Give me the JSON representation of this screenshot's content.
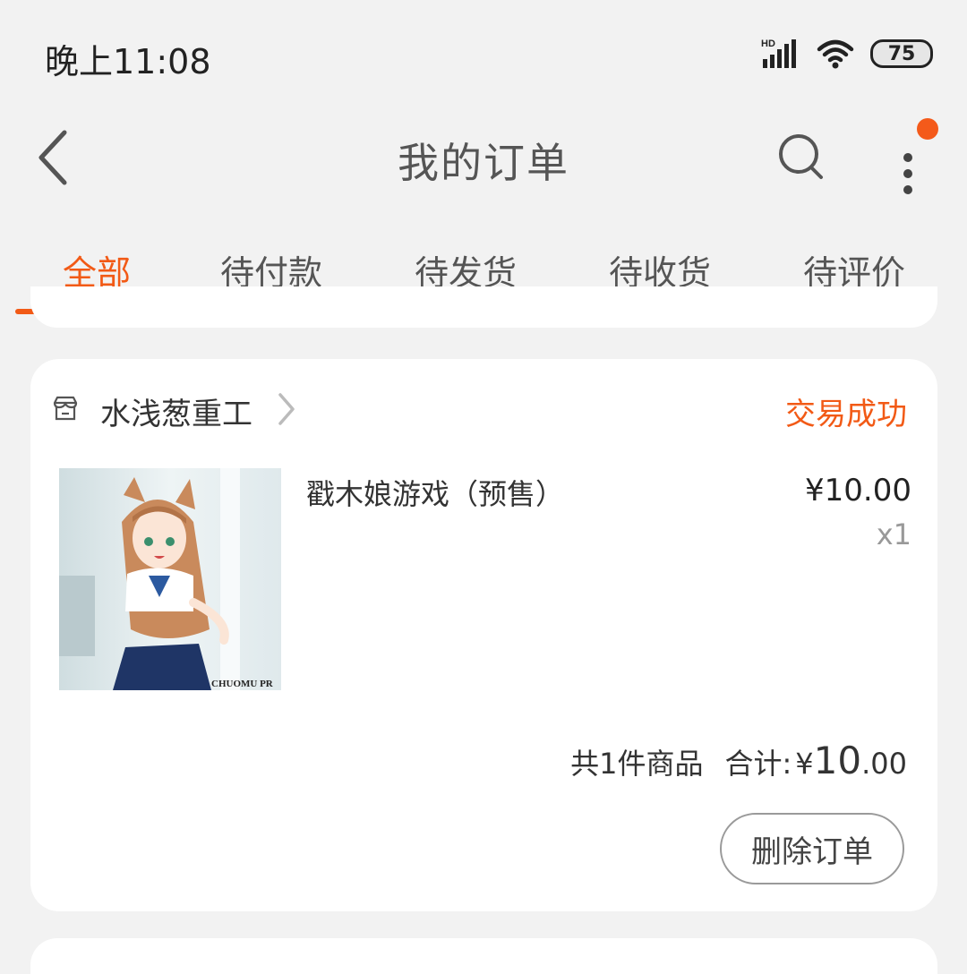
{
  "status_bar": {
    "time": "晚上11:08",
    "network_label": "HD",
    "battery_level": "75"
  },
  "header": {
    "title": "我的订单",
    "back_icon": "chevron-left-icon",
    "search_icon": "search-icon",
    "more_icon": "more-vertical-icon"
  },
  "tabs": [
    {
      "label": "全部",
      "active": true
    },
    {
      "label": "待付款",
      "active": false
    },
    {
      "label": "待发货",
      "active": false
    },
    {
      "label": "待收货",
      "active": false
    },
    {
      "label": "待评价",
      "active": false
    }
  ],
  "order": {
    "shop_name": "水浅葱重工",
    "status": "交易成功",
    "item": {
      "name": "戳木娘游戏（预售）",
      "price": "¥10.00",
      "quantity": "x1",
      "image_text": "CHUOMU PR"
    },
    "summary": {
      "count_text": "共1件商品",
      "total_label": "合计:",
      "currency": "¥",
      "total_int": "10",
      "total_dec": ".00"
    },
    "delete_label": "删除订单"
  },
  "colors": {
    "accent": "#f25a16",
    "background": "#f2f2f2",
    "card": "#ffffff",
    "notify_dot": "#f45a1a"
  }
}
